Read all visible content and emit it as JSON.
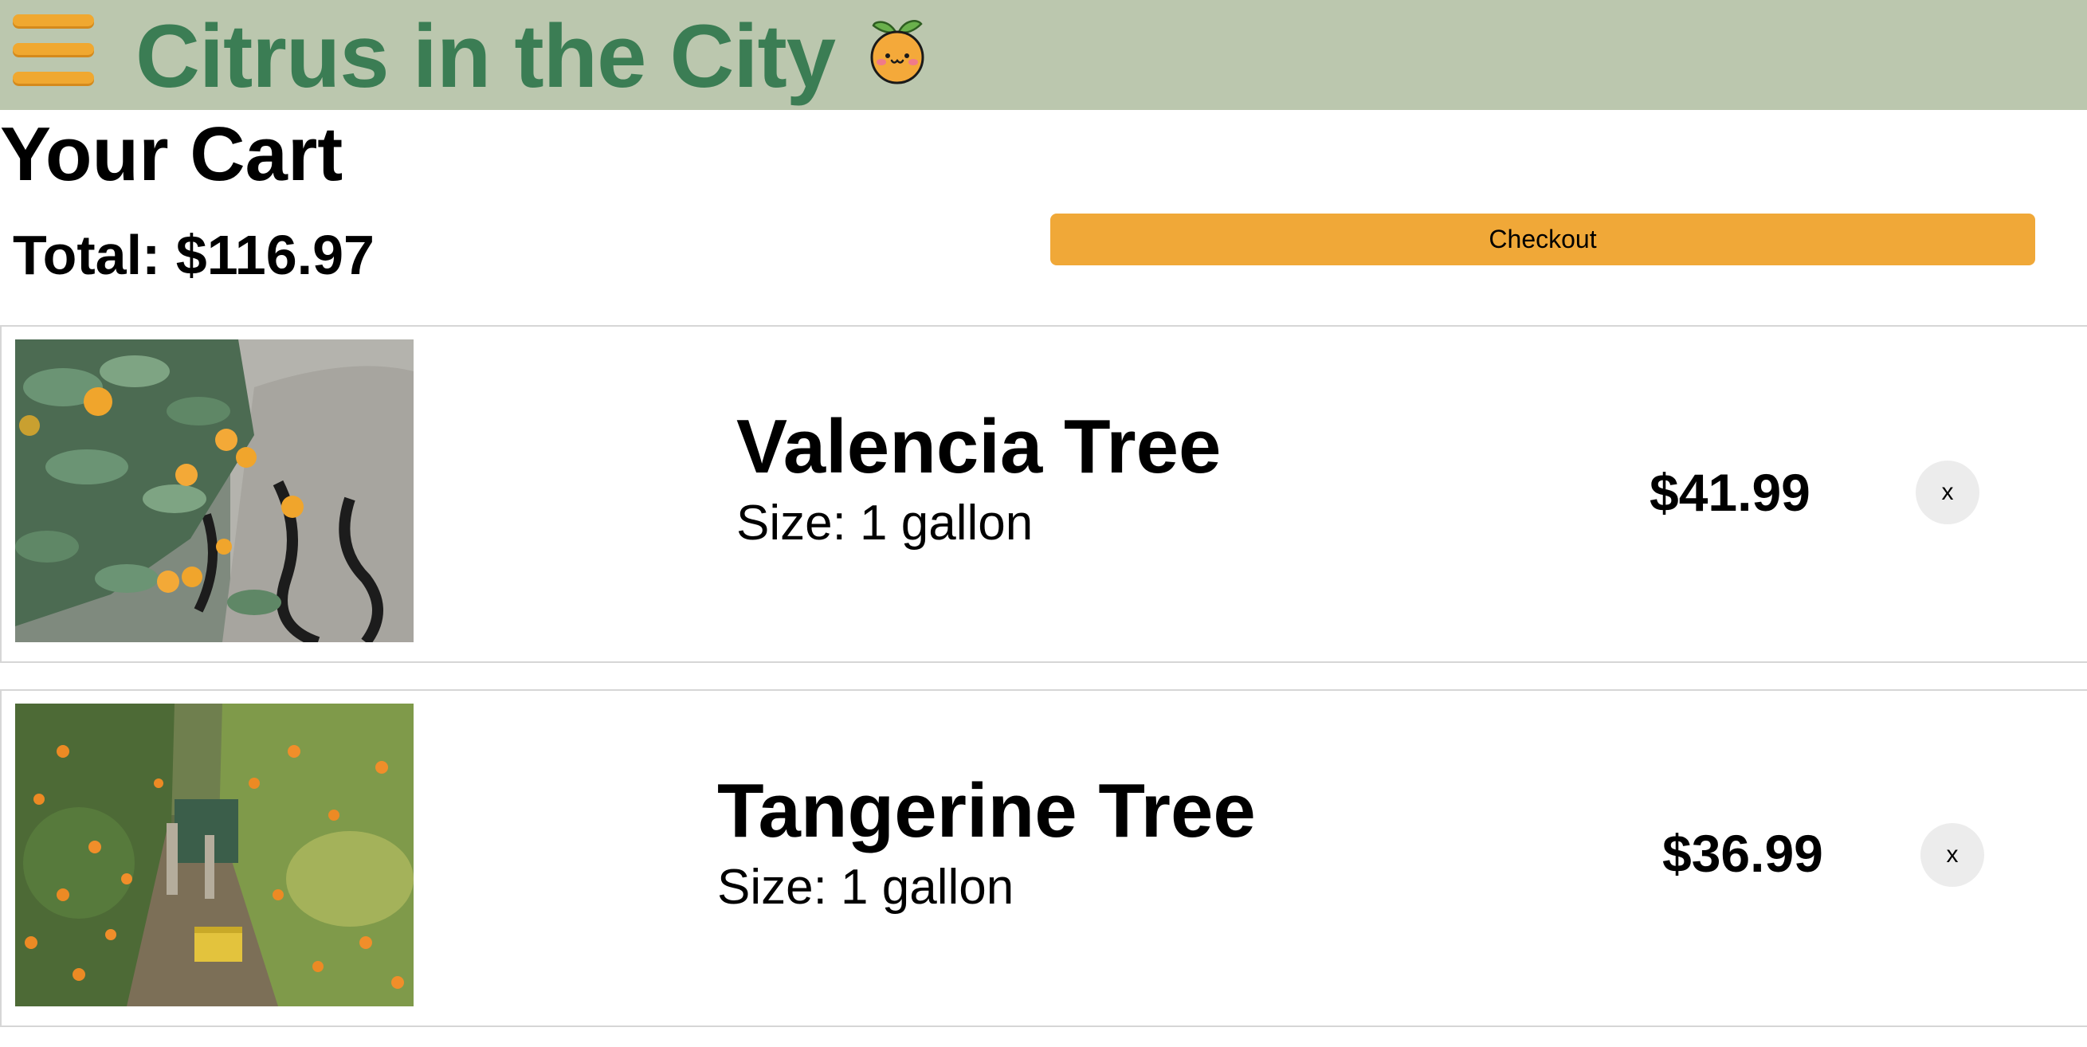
{
  "header": {
    "title": "Citrus in the City",
    "menu_icon": "hamburger-menu-icon",
    "logo_icon": "smiling-orange-icon",
    "brand_color": "#3b7d54",
    "accent_color": "#f0a830",
    "background_color": "#bbc7ae"
  },
  "cart": {
    "title": "Your Cart",
    "total_label": "Total: $116.97",
    "checkout_label": "Checkout",
    "items": [
      {
        "name": "Valencia Tree",
        "size": "Size: 1 gallon",
        "price": "$41.99",
        "remove_label": "x"
      },
      {
        "name": "Tangerine Tree",
        "size": "Size: 1 gallon",
        "price": "$36.99",
        "remove_label": "x"
      }
    ]
  }
}
